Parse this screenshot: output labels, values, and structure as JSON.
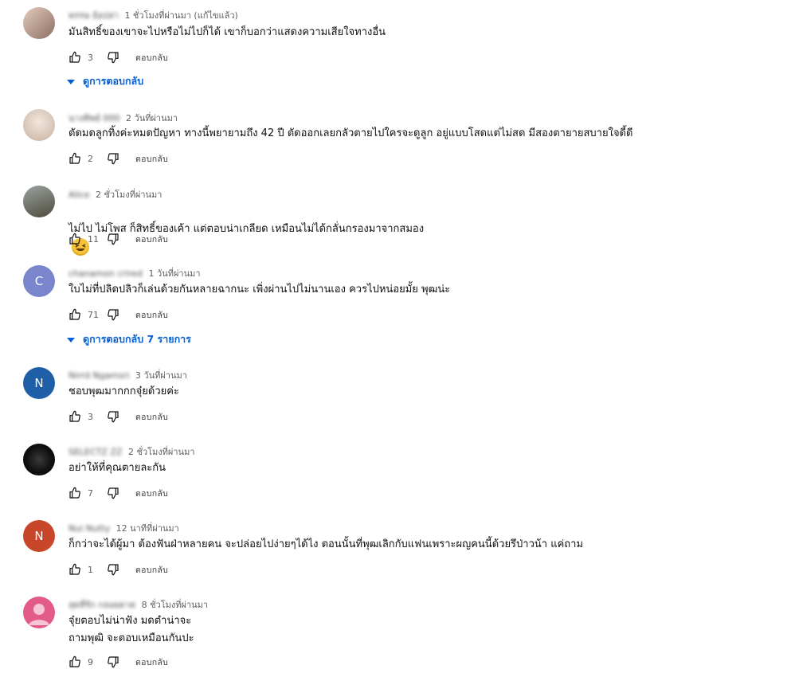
{
  "comments": [
    {
      "author": "พรรษ อ้อปล่า",
      "time": "1 ชั่วโมงที่ผ่านมา (แก้ไขแล้ว)",
      "text": "มันสิทธิ์ของเขาจะไปหรือไม่ไปก็ได้ เขาก็บอกว่าแสดงความเสียใจทางอื่น",
      "likes": "3",
      "reply": "ตอบกลับ",
      "view_replies": "ดูการตอบกลับ",
      "avatar_color": "#b89a8c"
    },
    {
      "author": "นางทิพย์ 000",
      "time": "2 วันที่ผ่านมา",
      "text": "ตัดมดลูกทิ้งค่ะหมดปัญหา ทางนี้พยายามถึง 42 ปี ตัดออกเลยกลัวตายไปใครจะดูลูก อยู่แบบโสดแต่ไม่สด มีสองตายายสบายใจดี้ดี",
      "likes": "2",
      "reply": "ตอบกลับ",
      "avatar_color": "#d8c6b8"
    },
    {
      "author": "Alice",
      "time": "2 ชั่วโมงที่ผ่านมา",
      "text": "ไม่ไป ไม่โพส ก็สิทธิ์ของเค้า แต่ตอบน่าเกลียด เหมือนไม่ได้กลั่นกรองมาจากสมอง",
      "likes": "11",
      "reply": "ตอบกลับ",
      "avatar_color": "#6c6a5a"
    },
    {
      "author": "chanamon crired",
      "time": "1 วันที่ผ่านมา",
      "text": "ใบไม่ที่ปลิดปลิวก็เล่นด้วยกันหลายฉากนะ เพิ่งผ่านไปไม่นานเอง ควรไปหน่อยมั้ย พุฒน่ะ",
      "likes": "71",
      "reply": "ตอบกลับ",
      "view_replies": "ดูการตอบกลับ 7 รายการ",
      "avatar_color": "#7986cb",
      "avatar_letter": "C"
    },
    {
      "author": "Nirrd Ngamsri",
      "time": "3 วันที่ผ่านมา",
      "text": "ชอบพุฒมากกกจุ๋ยด้วยค่ะ",
      "likes": "3",
      "reply": "ตอบกลับ",
      "avatar_color": "#1e5fa8",
      "avatar_letter": "N"
    },
    {
      "author": "SELECTZ ZZ",
      "time": "2 ชั่วโมงที่ผ่านมา",
      "text": "อย่าให้ที่คุณตายละกัน",
      "likes": "7",
      "reply": "ตอบกลับ",
      "avatar_color": "#111111"
    },
    {
      "author": "Nui Nutty",
      "time": "12 นาทีที่ผ่านมา",
      "text": "ก็กว่าจะได้ผู้มา ต้องฟันฝ่าหลายคน จะปล่อยไปง่ายๆได้ไง ตอนนั้นที่พุฒเลิกกับแฟนเพราะผญคนนี้ด้วยรึป่าวน้า แค่ถาม",
      "likes": "1",
      "reply": "ตอบกลับ",
      "avatar_color": "#c8462a",
      "avatar_letter": "N"
    },
    {
      "author": "สุดที่รัก กลอยดาด",
      "time": "8 ชั่วโมงที่ผ่านมา",
      "text": "จุ๋ยตอบไม่น่าฟัง มดตำน่าจะ\nถามพุฒิ จะตอบเหมือนกันปะ",
      "likes": "9",
      "reply": "ตอบกลับ",
      "avatar_color": "#e35b8a"
    }
  ]
}
